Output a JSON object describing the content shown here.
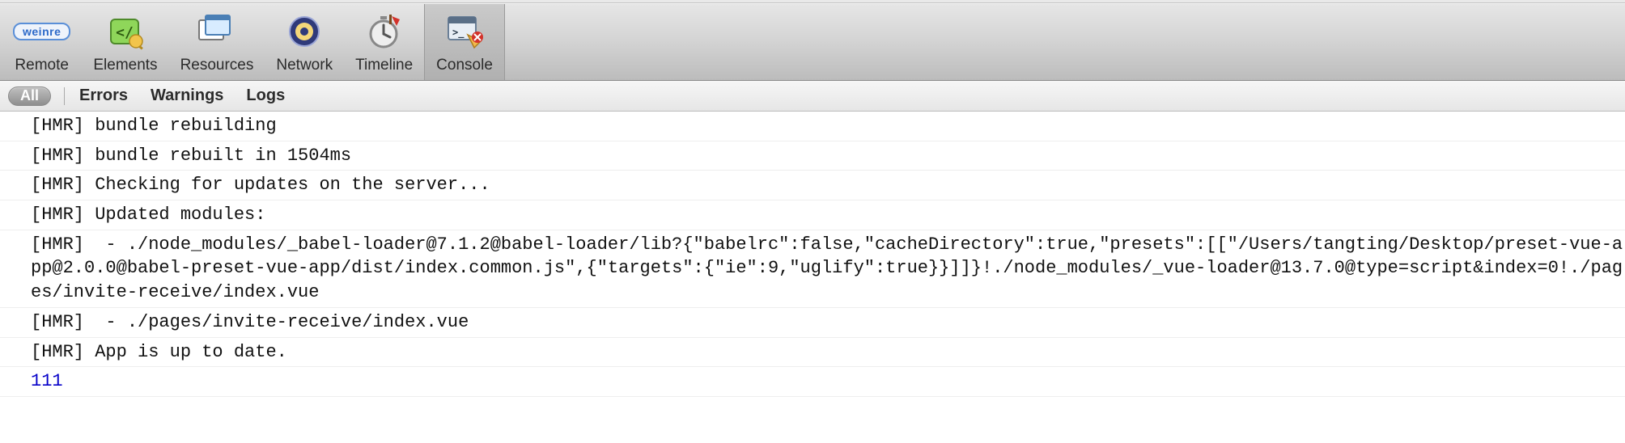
{
  "toolbar": {
    "tabs": [
      {
        "label": "Remote",
        "icon": "weinre-badge"
      },
      {
        "label": "Elements",
        "icon": "elements-icon"
      },
      {
        "label": "Resources",
        "icon": "resources-icon"
      },
      {
        "label": "Network",
        "icon": "network-icon"
      },
      {
        "label": "Timeline",
        "icon": "timeline-icon"
      },
      {
        "label": "Console",
        "icon": "console-icon",
        "active": true
      }
    ]
  },
  "filterbar": {
    "all": "All",
    "items": [
      "Errors",
      "Warnings",
      "Logs"
    ]
  },
  "weinre_badge_text": "weinre",
  "console": {
    "lines": [
      {
        "text": "[HMR] bundle rebuilding"
      },
      {
        "text": "[HMR] bundle rebuilt in 1504ms"
      },
      {
        "text": "[HMR] Checking for updates on the server..."
      },
      {
        "text": "[HMR] Updated modules:"
      },
      {
        "text": "[HMR]  - ./node_modules/_babel-loader@7.1.2@babel-loader/lib?{\"babelrc\":false,\"cacheDirectory\":true,\"presets\":[[\"/Users/tangting/Desktop/preset-vue-app@2.0.0@babel-preset-vue-app/dist/index.common.js\",{\"targets\":{\"ie\":9,\"uglify\":true}}]]}!./node_modules/_vue-loader@13.7.0@type=script&index=0!./pages/invite-receive/index.vue"
      },
      {
        "text": "[HMR]  - ./pages/invite-receive/index.vue"
      },
      {
        "text": "[HMR] App is up to date."
      },
      {
        "text": "111",
        "class": "blue"
      }
    ]
  }
}
